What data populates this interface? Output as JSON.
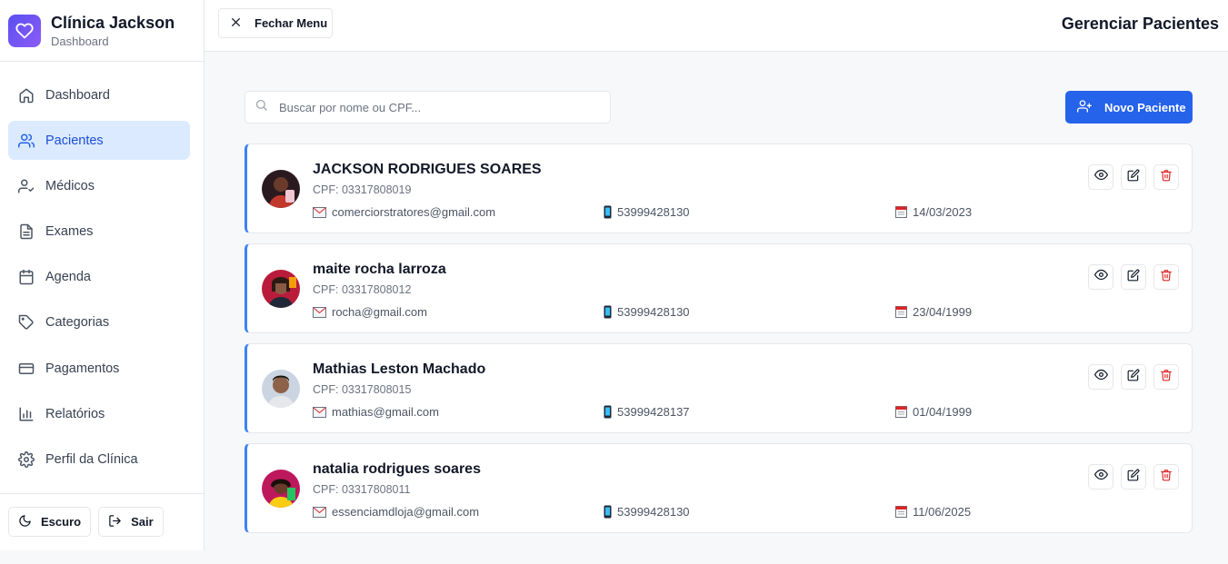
{
  "brand": {
    "title": "Clínica Jackson",
    "subtitle": "Dashboard",
    "accent": "#6d4ff2"
  },
  "nav": [
    {
      "label": "Dashboard",
      "icon": "home-icon",
      "active": false
    },
    {
      "label": "Pacientes",
      "icon": "users-icon",
      "active": true
    },
    {
      "label": "Médicos",
      "icon": "user-check-icon",
      "active": false
    },
    {
      "label": "Exames",
      "icon": "file-text-icon",
      "active": false
    },
    {
      "label": "Agenda",
      "icon": "calendar-icon",
      "active": false
    },
    {
      "label": "Categorias",
      "icon": "tag-icon",
      "active": false
    },
    {
      "label": "Pagamentos",
      "icon": "credit-card-icon",
      "active": false
    },
    {
      "label": "Relatórios",
      "icon": "bar-chart-icon",
      "active": false
    },
    {
      "label": "Perfil da Clínica",
      "icon": "settings-icon",
      "active": false
    }
  ],
  "footer": {
    "theme_label": "Escuro",
    "logout_label": "Sair"
  },
  "header": {
    "close_menu_label": "Fechar Menu",
    "page_title": "Gerenciar Pacientes"
  },
  "toolbar": {
    "search_placeholder": "Buscar por nome ou CPF...",
    "new_patient_label": "Novo Paciente",
    "primary_color": "#2563eb"
  },
  "patients": [
    {
      "name": "JACKSON RODRIGUES SOARES",
      "cpf": "CPF: 03317808019",
      "email": "comerciorstratores@gmail.com",
      "phone": "53999428130",
      "birthdate": "14/03/2023"
    },
    {
      "name": "maite rocha larroza",
      "cpf": "CPF: 03317808012",
      "email": "rocha@gmail.com",
      "phone": "53999428130",
      "birthdate": "23/04/1999"
    },
    {
      "name": "Mathias Leston Machado",
      "cpf": "CPF: 03317808015",
      "email": "mathias@gmail.com",
      "phone": "53999428137",
      "birthdate": "01/04/1999"
    },
    {
      "name": "natalia rodrigues soares",
      "cpf": "CPF: 03317808011",
      "email": "essenciamdloja@gmail.com",
      "phone": "53999428130",
      "birthdate": "11/06/2025"
    }
  ]
}
